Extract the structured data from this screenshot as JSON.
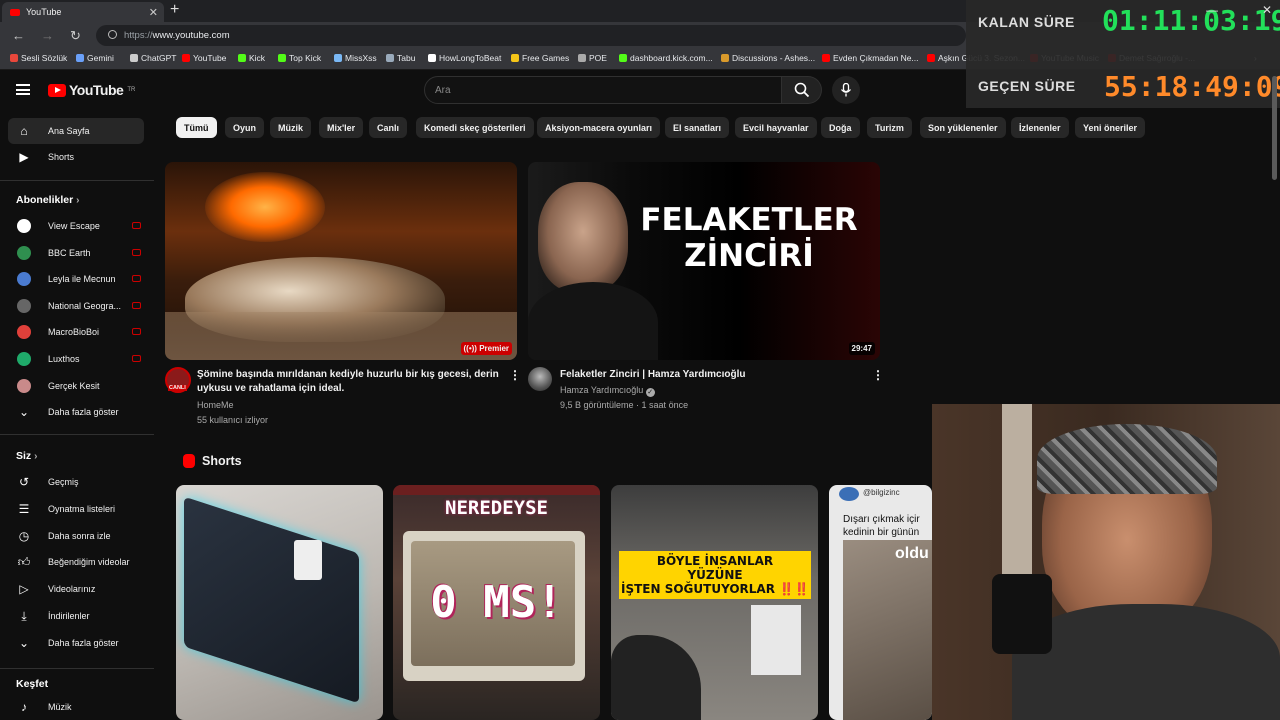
{
  "browser": {
    "tab_title": "YouTube",
    "url_scheme": "https://",
    "url_host": "www.youtube.com",
    "bookmarks": [
      {
        "label": "Sesli Sözlük",
        "color": "#e8473b"
      },
      {
        "label": "Gemini",
        "color": "#6aa0f8"
      },
      {
        "label": "ChatGPT",
        "color": "#cccccc"
      },
      {
        "label": "YouTube",
        "color": "#ff0000"
      },
      {
        "label": "Kick",
        "color": "#53fc18"
      },
      {
        "label": "Top Kick",
        "color": "#53fc18"
      },
      {
        "label": "MissXss",
        "color": "#7ab8f5"
      },
      {
        "label": "Tabu",
        "color": "#9ab"
      },
      {
        "label": "HowLongToBeat",
        "color": "#ffffff"
      },
      {
        "label": "Free Games",
        "color": "#f5c518"
      },
      {
        "label": "POE",
        "color": "#aaaaaa"
      },
      {
        "label": "dashboard.kick.com...",
        "color": "#53fc18"
      },
      {
        "label": "Discussions - Ashes...",
        "color": "#d99a2b"
      },
      {
        "label": "Evden Çıkmadan Ne...",
        "color": "#ff0000"
      },
      {
        "label": "Aşkın Gücü 3. Sezon...",
        "color": "#ff0000"
      },
      {
        "label": "YouTube Music",
        "color": "#ff0000"
      },
      {
        "label": "Demet Sağıroğlu -...",
        "color": "#ff0000"
      }
    ]
  },
  "overlay": {
    "remaining_label": "KALAN SÜRE",
    "remaining_value": "01:11:03:19",
    "elapsed_label": "GEÇEN SÜRE",
    "elapsed_value": "55:18:49:09",
    "remaining_color": "#22e05a",
    "elapsed_color": "#ff8a2a"
  },
  "youtube": {
    "logo_text": "YouTube",
    "logo_sup": "TR",
    "search_placeholder": "Ara",
    "sidebar": {
      "main": [
        {
          "label": "Ana Sayfa",
          "icon": "home-icon",
          "active": true
        },
        {
          "label": "Shorts",
          "icon": "shorts-icon"
        }
      ],
      "subscriptions_title": "Abonelikler",
      "subscriptions": [
        {
          "label": "View Escape",
          "color": "#ffffff",
          "live": true
        },
        {
          "label": "BBC Earth",
          "color": "#2f8f4f",
          "live": true
        },
        {
          "label": "Leyla ile Mecnun",
          "color": "#4a7bd0",
          "live": true
        },
        {
          "label": "National Geogra...",
          "color": "#666666",
          "live": true
        },
        {
          "label": "MacroBioBoi",
          "color": "#e0403a",
          "live": true
        },
        {
          "label": "Luxthos",
          "color": "#1faa6a",
          "live": true
        },
        {
          "label": "Gerçek Kesit",
          "color": "#c98a8a",
          "live": false
        }
      ],
      "show_more": "Daha fazla göster",
      "you_title": "Siz",
      "you": [
        {
          "label": "Geçmiş",
          "icon": "history-icon"
        },
        {
          "label": "Oynatma listeleri",
          "icon": "playlist-icon"
        },
        {
          "label": "Daha sonra izle",
          "icon": "watch-later-icon"
        },
        {
          "label": "Beğendiğim videolar",
          "icon": "like-icon"
        },
        {
          "label": "Videolarınız",
          "icon": "your-videos-icon"
        },
        {
          "label": "İndirilenler",
          "icon": "download-icon"
        },
        {
          "label": "Daha fazla göster",
          "icon": "chevron-down-icon"
        }
      ],
      "explore_title": "Keşfet",
      "explore": [
        {
          "label": "Müzik",
          "icon": "music-icon"
        }
      ]
    },
    "chips": [
      "Tümü",
      "Oyun",
      "Müzik",
      "Mix'ler",
      "Canlı",
      "Komedi skeç gösterileri",
      "Aksiyon-macera oyunları",
      "El sanatları",
      "Evcil hayvanlar",
      "Doğa",
      "Turizm",
      "Son yüklenenler",
      "İzlenenler",
      "Yeni öneriler"
    ],
    "videos": [
      {
        "title_line1": "Şömine başında mırıldanan kediyle huzurlu bir kış gecesi, derin",
        "title_line2": "uykusu ve rahatlama için ideal.",
        "channel": "HomeMe",
        "meta": "55 kullanıcı izliyor",
        "badge": "Premier",
        "avatar_badge": "CANLI"
      },
      {
        "title_line1": "Felaketler Zinciri | Hamza Yardımcıoğlu",
        "channel": "Hamza Yardımcıoğlu",
        "meta": "9,5 B görüntüleme · 1 saat önce",
        "duration": "29:47",
        "thumb_text_1": "FELAKETLER",
        "thumb_text_2": "ZİNCİRİ"
      }
    ],
    "shorts_title": "Shorts",
    "shorts": [
      {
        "caption": ""
      },
      {
        "caption_top": "NEREDEYSE",
        "caption_big": "0 MS!"
      },
      {
        "caption_1": "BÖYLE İNSANLAR",
        "caption_2": "YÜZÜNE",
        "caption_3": "İŞTEN SOĞUTUYORLAR ‼️‼️"
      },
      {
        "handle": "@bilgizinc",
        "text_1": "Dışarı çıkmak içir",
        "text_2": "kedinin bir günün",
        "text_3": "oldu"
      }
    ]
  }
}
